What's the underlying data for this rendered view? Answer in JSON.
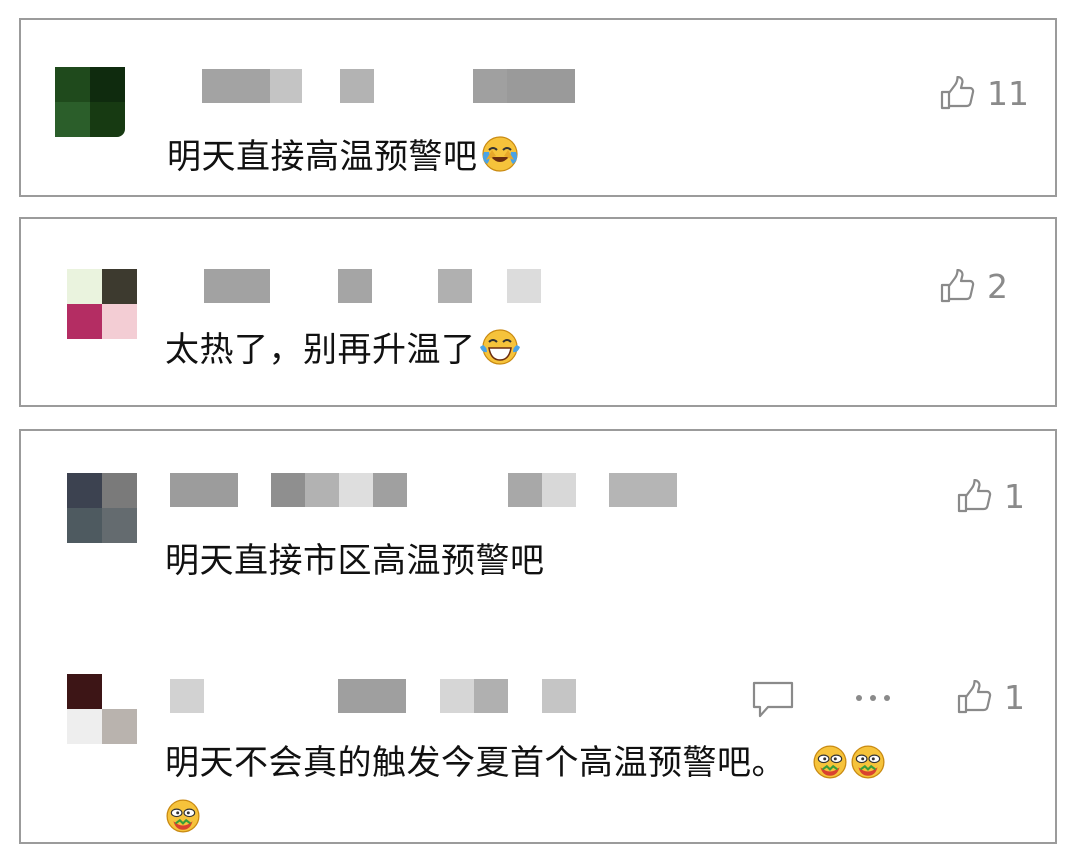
{
  "comments": [
    {
      "text": "明天直接高温预警吧",
      "emoji": "crying-laughing-emoji",
      "likes": "11"
    },
    {
      "text": "太热了，别再升温了",
      "emoji": "tears-of-joy-emoji",
      "likes": "2"
    },
    {
      "text": "明天直接市区高温预警吧",
      "likes": "1"
    },
    {
      "text": "明天不会真的触发今夏首个高温预警吧。",
      "emoji": "hot-face-emoji",
      "emoji_count": 3,
      "likes": "1",
      "actions": {
        "reply_icon": "chat-bubble-icon",
        "more_icon": "more-dots-icon"
      }
    }
  ],
  "colors": {
    "border": "#9b9b9b",
    "muted": "#8a8a8a",
    "blur": "#a0a0a0"
  },
  "icons": {
    "like": "thumbs-up-icon"
  }
}
